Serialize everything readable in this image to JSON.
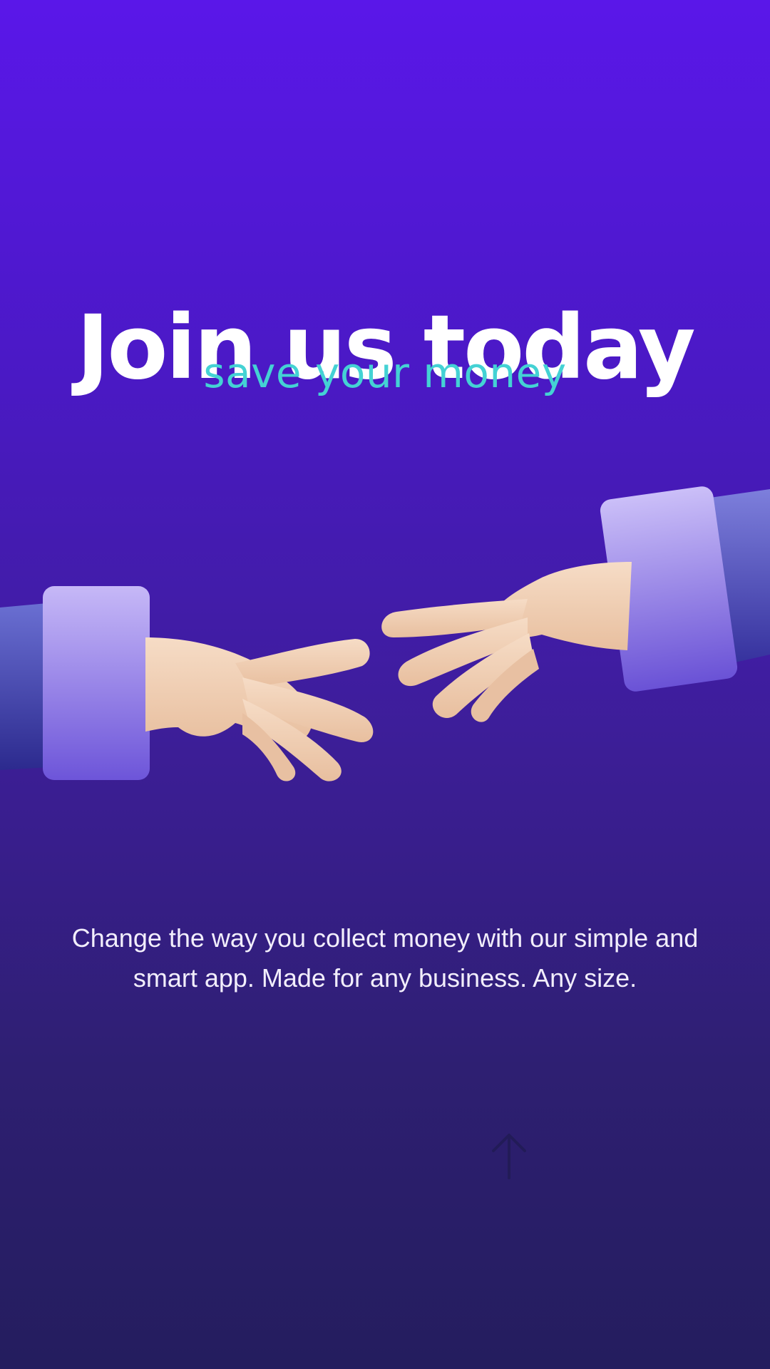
{
  "onboarding": {
    "title": "Join us today",
    "subtitle": "save your money",
    "description": "Change the way you collect money with our simple and smart app. Made for any business. Any size.",
    "illustration": "handshake-hands-illustration",
    "swipe_hint_icon": "arrow-up-icon"
  },
  "colors": {
    "background_top": "#5a17e9",
    "background_bottom": "#241d5e",
    "title": "#ffffff",
    "subtitle": "#44d2d4",
    "body_text": "#f2eefc",
    "sleeve": "#9b83ee",
    "skin": "#f2cfb4"
  }
}
